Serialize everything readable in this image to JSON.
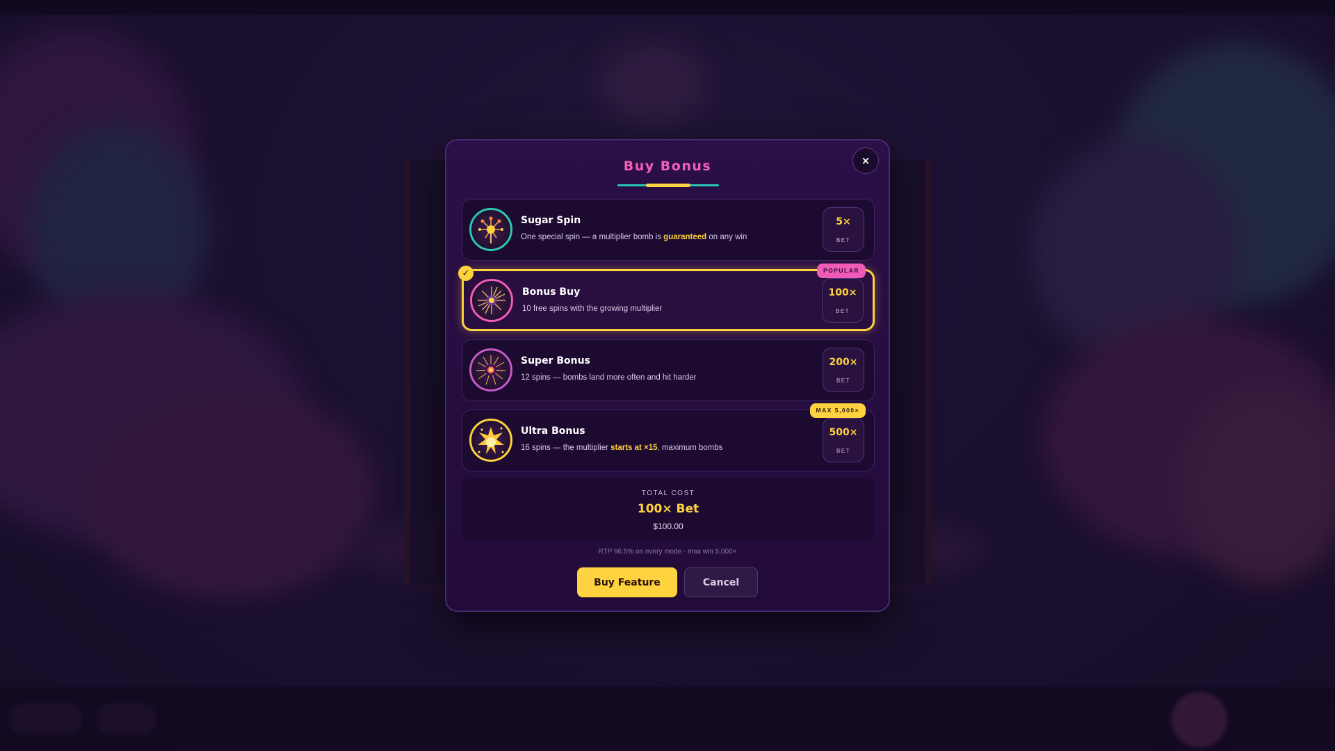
{
  "modal": {
    "title": "Buy Bonus",
    "close_label": "×"
  },
  "options": [
    {
      "name": "Sugar Spin",
      "desc_before": "One special spin — a multiplier bomb is ",
      "desc_highlight": "guaranteed",
      "desc_after": " on any win",
      "price": "5×",
      "unit": "BET",
      "icon": "lollipop-sparkler-icon",
      "ring_color": "#2cc9b2",
      "selected": false
    },
    {
      "name": "Bonus Buy",
      "desc_before": "10 free spins with the growing multiplier",
      "desc_highlight": "",
      "desc_after": "",
      "price": "100×",
      "unit": "BET",
      "badge": "POPULAR",
      "icon": "firework-burst-icon",
      "ring_color": "#f05bb8",
      "selected": true,
      "check": "✓"
    },
    {
      "name": "Super Bonus",
      "desc_before": "12 spins — bombs land more often and hit harder",
      "desc_highlight": "",
      "desc_after": "",
      "price": "200×",
      "unit": "BET",
      "icon": "sparkler-starburst-icon",
      "ring_color": "#c25cc8",
      "selected": false
    },
    {
      "name": "Ultra Bonus",
      "desc_before": "16 spins — the multiplier ",
      "desc_highlight": "starts at ×15",
      "desc_after": ", maximum bombs",
      "price": "500×",
      "unit": "BET",
      "badge": "MAX 5,000×",
      "icon": "golden-explosion-icon",
      "ring_color": "#ffd23f",
      "selected": false
    }
  ],
  "total": {
    "label": "TOTAL COST",
    "value": "100× Bet",
    "money": "$100.00"
  },
  "note": "RTP 96.5% on every mode · max win 5,000×",
  "buttons": {
    "buy": "Buy Feature",
    "cancel": "Cancel"
  },
  "colors": {
    "accent_pink": "#f25fb5",
    "accent_yellow": "#ffd23f",
    "accent_teal": "#27c6b4",
    "modal_bg": "#250c3e"
  }
}
